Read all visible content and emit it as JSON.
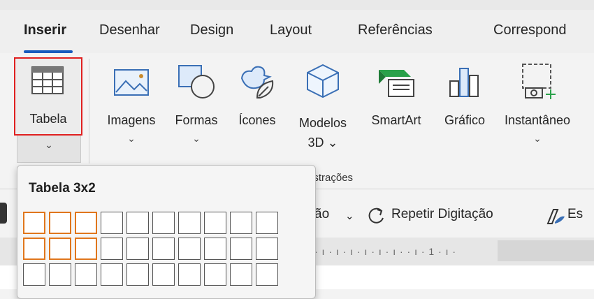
{
  "tabs": [
    {
      "label": "Inserir",
      "active": true
    },
    {
      "label": "Desenhar",
      "active": false
    },
    {
      "label": "Design",
      "active": false
    },
    {
      "label": "Layout",
      "active": false
    },
    {
      "label": "Referências",
      "active": false
    },
    {
      "label": "Correspond",
      "active": false
    }
  ],
  "ribbon": {
    "tabela": {
      "label": "Tabela",
      "chevron": "⌄"
    },
    "imagens": {
      "label": "Imagens",
      "chevron": "⌄"
    },
    "formas": {
      "label": "Formas",
      "chevron": "⌄"
    },
    "icones": {
      "label": "Ícones"
    },
    "modelos": {
      "label": "Modelos",
      "label2": "3D ⌄"
    },
    "smartart": {
      "label": "SmartArt"
    },
    "grafico": {
      "label": "Gráfico"
    },
    "instantaneo": {
      "label": "Instantâneo",
      "chevron": "⌄"
    },
    "group_label": "ustrações"
  },
  "toolbar2": {
    "partial": "ão",
    "chevron": "⌄",
    "repeat": "Repetir Digitação",
    "estilos_partial": "Es"
  },
  "ruler": {
    "marks": "· ı · ı · ı · ı · ı · ı ·      · ı · 1 · ı ·"
  },
  "popup": {
    "title": "Tabela 3x2",
    "selected_cols": 3,
    "selected_rows": 2
  },
  "colors": {
    "accent": "#185abd",
    "highlight": "#e02020",
    "selection": "#e0761c",
    "smartart_green": "#2aa14a"
  }
}
